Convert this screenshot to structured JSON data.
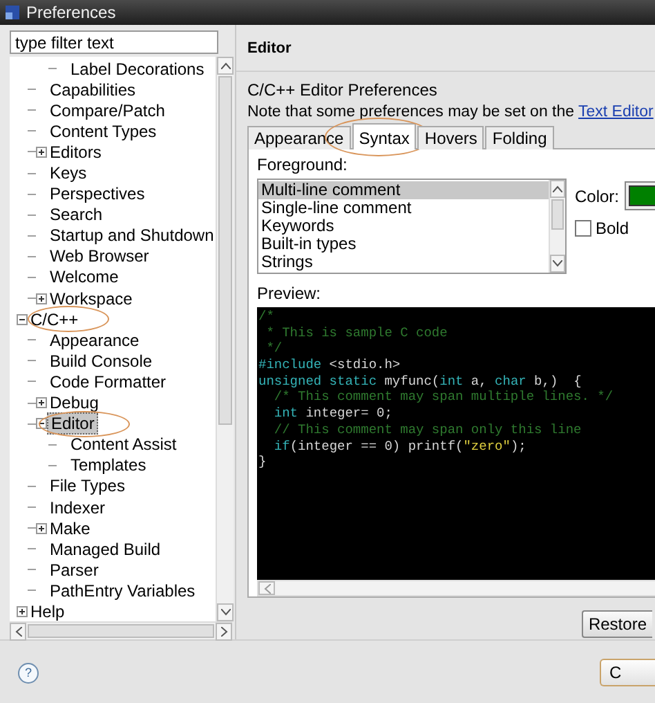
{
  "window": {
    "title": "Preferences"
  },
  "sidebar": {
    "filter": {
      "placeholder": "type filter text"
    },
    "tree": [
      {
        "children": [
          {
            "children": [
              {
                "label": "Label Decorations"
              }
            ]
          },
          {
            "label": "Capabilities"
          },
          {
            "label": "Compare/Patch"
          },
          {
            "label": "Content Types"
          },
          {
            "label": "Editors",
            "expanded": false,
            "selected": false
          },
          {
            "label": "Keys"
          },
          {
            "label": "Perspectives"
          },
          {
            "label": "Search"
          },
          {
            "label": "Startup and Shutdown"
          },
          {
            "label": "Web Browser"
          },
          {
            "label": "Welcome"
          },
          {
            "label": "Workspace",
            "expanded": false,
            "selected": false
          }
        ]
      },
      {
        "label": "C/C++",
        "expanded": true,
        "selected": false,
        "circled": true,
        "children": [
          {
            "label": "Appearance"
          },
          {
            "label": "Build Console"
          },
          {
            "label": "Code Formatter"
          },
          {
            "label": "Debug",
            "expanded": false,
            "selected": false
          },
          {
            "label": "Editor",
            "expanded": true,
            "selected": true,
            "circled": true,
            "children": [
              {
                "label": "Content Assist"
              },
              {
                "label": "Templates"
              }
            ]
          },
          {
            "label": "File Types"
          },
          {
            "label": "Indexer"
          },
          {
            "label": "Make",
            "expanded": false,
            "selected": false
          },
          {
            "label": "Managed Build"
          },
          {
            "label": "Parser"
          },
          {
            "label": "PathEntry Variables"
          }
        ]
      },
      {
        "label": "Help",
        "expanded": false,
        "selected": false
      }
    ]
  },
  "page": {
    "header": "Editor",
    "title": "C/C++ Editor Preferences",
    "note": "Note that some preferences may be set on the ",
    "note_link": "Text Editor",
    "tabs": [
      {
        "label": "Appearance",
        "selected": false
      },
      {
        "label": "Syntax",
        "selected": true,
        "circled": true
      },
      {
        "label": "Hovers",
        "selected": false
      },
      {
        "label": "Folding",
        "selected": false
      }
    ],
    "foreground_label": "Foreground:",
    "elements": [
      {
        "label": "Multi-line comment",
        "selected": true
      },
      {
        "label": "Single-line comment",
        "selected": false
      },
      {
        "label": "Keywords",
        "selected": false
      },
      {
        "label": "Built-in types",
        "selected": false
      },
      {
        "label": "Strings",
        "selected": false
      }
    ],
    "color_label": "Color:",
    "color": "#008000",
    "bold": {
      "label": "Bold",
      "checked": false
    },
    "preview_label": "Preview:",
    "code": [
      [
        {
          "kind": "comment",
          "text": "/*"
        }
      ],
      [
        {
          "kind": "comment",
          "text": " * This is sample C code"
        }
      ],
      [
        {
          "kind": "comment",
          "text": " */"
        }
      ],
      [
        {
          "kind": "keyword",
          "text": "#include"
        },
        {
          "kind": "text",
          "text": " <stdio.h>"
        }
      ],
      [
        {
          "kind": "keyword",
          "text": "unsigned static"
        },
        {
          "kind": "text",
          "text": " myfunc("
        },
        {
          "kind": "keyword",
          "text": "int"
        },
        {
          "kind": "text",
          "text": " a, "
        },
        {
          "kind": "keyword",
          "text": "char"
        },
        {
          "kind": "text",
          "text": " b,)  {"
        }
      ],
      [
        {
          "kind": "comment",
          "text": "  /* This comment may span multiple lines. */"
        }
      ],
      [
        {
          "kind": "keyword",
          "text": "  int"
        },
        {
          "kind": "text",
          "text": " integer= 0;"
        }
      ],
      [
        {
          "kind": "comment",
          "text": "  // This comment may span only this line"
        }
      ],
      [
        {
          "kind": "keyword",
          "text": "  if"
        },
        {
          "kind": "text",
          "text": "(integer == 0) printf("
        },
        {
          "kind": "string",
          "text": "\"zero\""
        },
        {
          "kind": "text",
          "text": ");"
        }
      ],
      [
        {
          "kind": "text",
          "text": "}"
        }
      ]
    ],
    "restore_button": "Restore"
  },
  "footer": {
    "help": "?",
    "button": "C"
  }
}
